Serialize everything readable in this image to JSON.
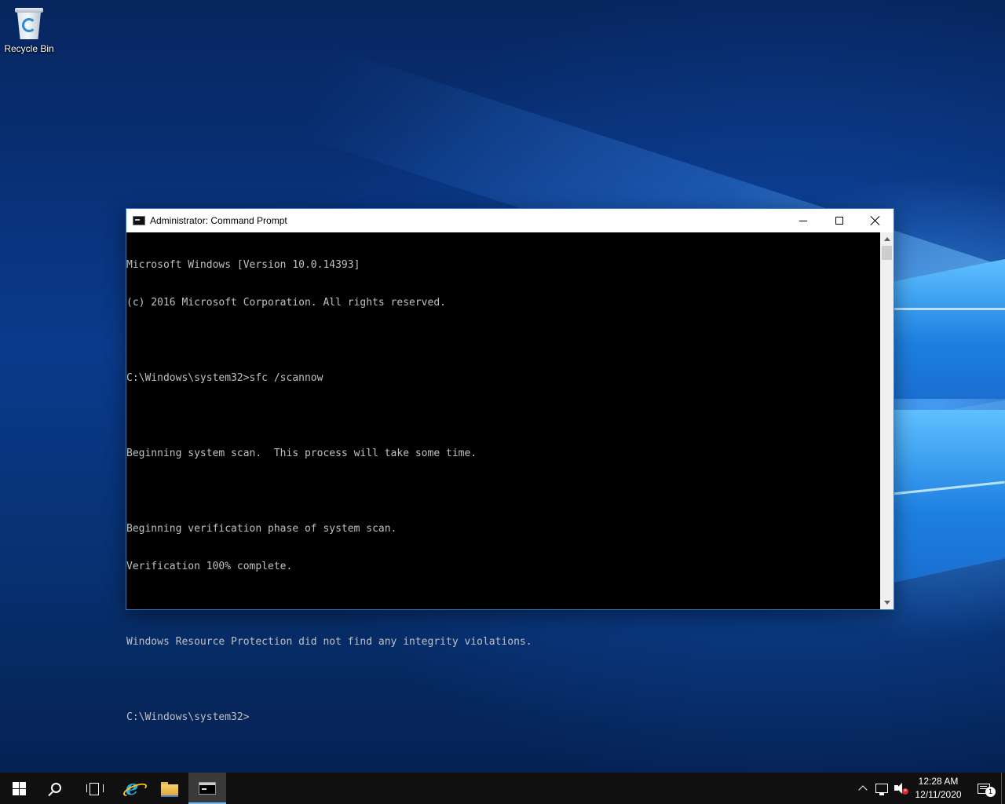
{
  "desktop": {
    "icons": [
      {
        "label": "Recycle Bin",
        "icon": "recycle-bin-icon"
      }
    ]
  },
  "window": {
    "title": "Administrator: Command Prompt",
    "icon": "cmd-icon",
    "controls": {
      "minimize": "minimize-icon",
      "maximize": "maximize-icon",
      "close": "close-icon"
    },
    "console_lines": [
      "Microsoft Windows [Version 10.0.14393]",
      "(c) 2016 Microsoft Corporation. All rights reserved.",
      "",
      "C:\\Windows\\system32>sfc /scannow",
      "",
      "Beginning system scan.  This process will take some time.",
      "",
      "Beginning verification phase of system scan.",
      "Verification 100% complete.",
      "",
      "Windows Resource Protection did not find any integrity violations.",
      "",
      "C:\\Windows\\system32>"
    ],
    "colors": {
      "console_bg": "#000000",
      "console_fg": "#c0c0c0",
      "border": "#2b79c4"
    }
  },
  "taskbar": {
    "items": [
      {
        "name": "start",
        "icon": "windows-logo-icon"
      },
      {
        "name": "search",
        "icon": "search-icon"
      },
      {
        "name": "task-view",
        "icon": "task-view-icon"
      },
      {
        "name": "internet-explorer",
        "icon": "internet-explorer-icon",
        "glyph": "e"
      },
      {
        "name": "file-explorer",
        "icon": "folder-icon"
      },
      {
        "name": "command-prompt",
        "icon": "cmd-icon",
        "active": true
      }
    ],
    "tray": {
      "clock_time": "12:28 AM",
      "clock_date": "12/11/2020",
      "notification_count": "1",
      "volume_error": "×"
    }
  }
}
